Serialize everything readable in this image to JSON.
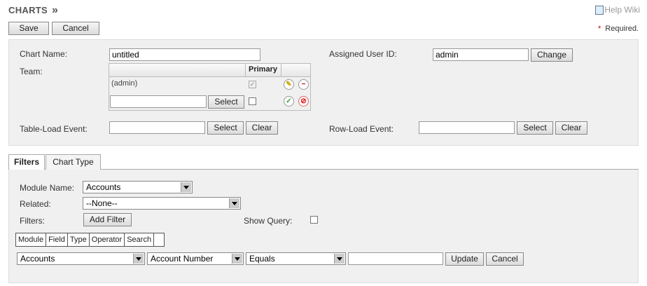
{
  "header": {
    "title": "CHARTS",
    "arrow": "»",
    "help_label": "Help Wiki",
    "required_note": "Required."
  },
  "toolbar": {
    "save_label": "Save",
    "cancel_label": "Cancel"
  },
  "details": {
    "chart_name_label": "Chart Name:",
    "chart_name_value": "untitled",
    "assigned_user_label": "Assigned User ID:",
    "assigned_user_value": "admin",
    "change_label": "Change",
    "team_label": "Team:",
    "team_primary_header": "Primary",
    "team_existing": "(admin)",
    "team_select_label": "Select",
    "table_load_label": "Table-Load Event:",
    "row_load_label": "Row-Load Event:",
    "select_label": "Select",
    "clear_label": "Clear"
  },
  "tabs": [
    {
      "label": "Filters",
      "active": true
    },
    {
      "label": "Chart Type",
      "active": false
    }
  ],
  "filters": {
    "module_name_label": "Module Name:",
    "module_name_value": "Accounts",
    "related_label": "Related:",
    "related_value": "--None--",
    "filters_label": "Filters:",
    "add_filter_label": "Add Filter",
    "show_query_label": "Show Query:",
    "columns": [
      "Module",
      "Field",
      "Type",
      "Operator",
      "Search"
    ],
    "row": {
      "module": "Accounts",
      "field": "Account Number",
      "operator": "Equals",
      "search_value": "",
      "update_label": "Update",
      "cancel_label": "Cancel"
    }
  }
}
